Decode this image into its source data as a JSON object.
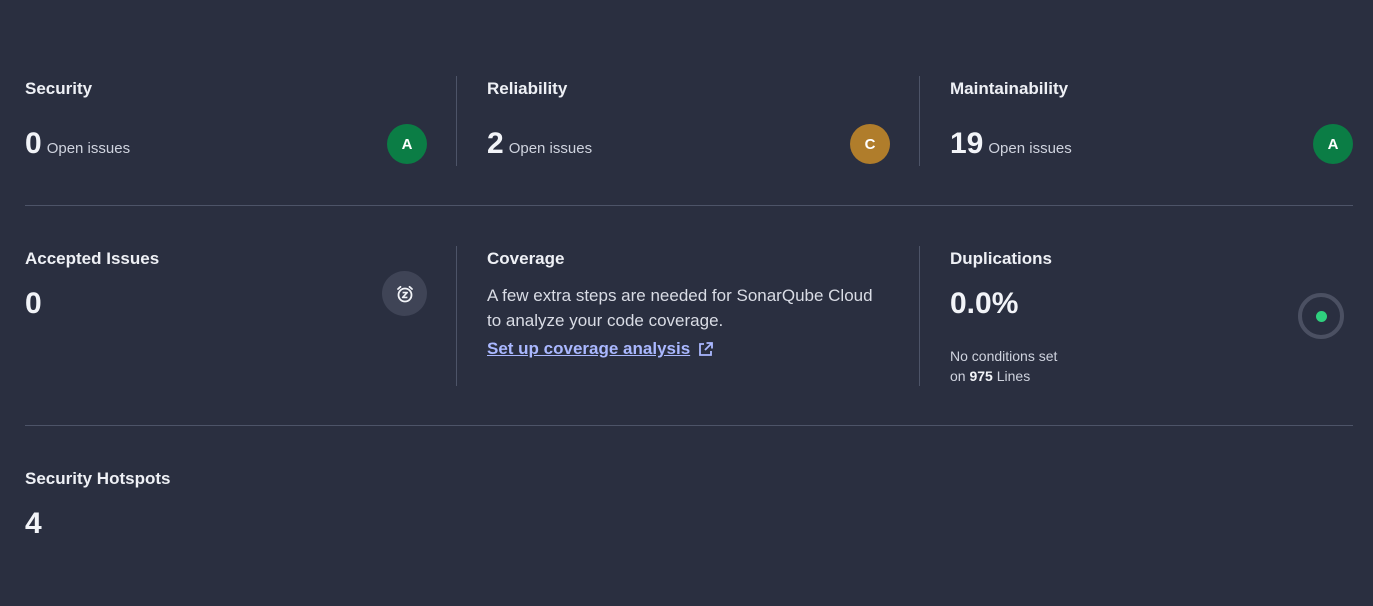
{
  "row1": {
    "security": {
      "title": "Security",
      "value": "0",
      "label": "Open issues",
      "rating": "A",
      "rating_color": "#0b7d45"
    },
    "reliability": {
      "title": "Reliability",
      "value": "2",
      "label": "Open issues",
      "rating": "C",
      "rating_color": "#b07d2b"
    },
    "maintainability": {
      "title": "Maintainability",
      "value": "19",
      "label": "Open issues",
      "rating": "A",
      "rating_color": "#0b7d45"
    }
  },
  "row2": {
    "accepted": {
      "title": "Accepted Issues",
      "value": "0",
      "icon": "snooze-clock-icon"
    },
    "coverage": {
      "title": "Coverage",
      "message": "A few extra steps are needed for SonarQube Cloud to analyze your code coverage.",
      "link": "Set up coverage analysis",
      "link_icon": "external-link-icon"
    },
    "duplications": {
      "title": "Duplications",
      "value": "0.0%",
      "note_line1": "No conditions set",
      "note_prefix": "on",
      "note_lines": "975",
      "note_suffix": "Lines",
      "indicator_color": "#2fd07e"
    }
  },
  "row3": {
    "hotspots": {
      "title": "Security Hotspots",
      "value": "4"
    }
  }
}
